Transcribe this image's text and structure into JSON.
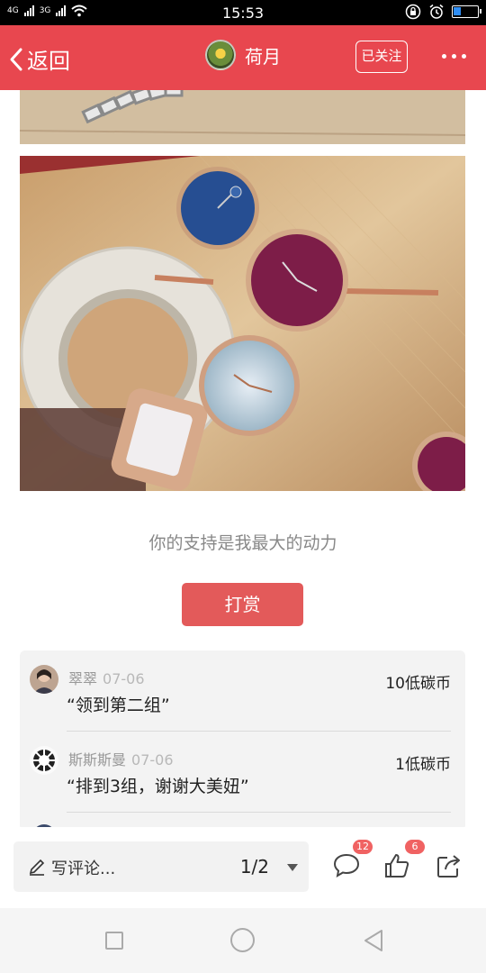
{
  "status_bar": {
    "network_1": "4G",
    "network_2": "3G",
    "time": "15:53",
    "battery_level": 0.3
  },
  "header": {
    "back_label": "返回",
    "username": "荷月",
    "follow_label": "已关注"
  },
  "post": {
    "support_text": "你的支持是我最大的动力",
    "tip_button": "打赏"
  },
  "comments": [
    {
      "name": "翠翠",
      "date": "07-06",
      "text": "“领到第二组”",
      "coins": "10低碳币"
    },
    {
      "name": "斯斯斯曼",
      "date": "07-06",
      "text": "“排到3组，谢谢大美妞”",
      "coins": "1低碳币"
    }
  ],
  "bottom_bar": {
    "comment_placeholder": "写评论...",
    "page_indicator": "1/2",
    "comment_count": "12",
    "like_count": "6"
  },
  "icons": {
    "back": "chevron-left-icon",
    "more": "more-dots-icon",
    "pen": "pen-icon",
    "comment": "comment-icon",
    "like": "thumbs-up-icon",
    "share": "share-icon"
  },
  "colors": {
    "header_red": "#e8474f",
    "tip_button": "#e35a5a",
    "badge": "#f06262"
  }
}
